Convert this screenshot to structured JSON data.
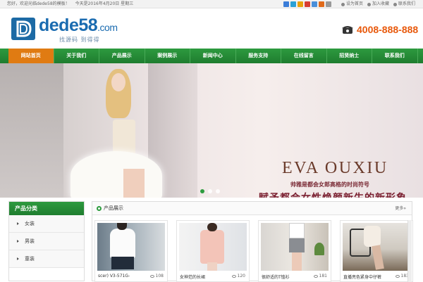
{
  "topbar": {
    "welcome": "您好，欢迎光临dede58的模板！",
    "date": "今天是2016年4月20日 星期三",
    "links": [
      "设为首页",
      "加入收藏",
      "联系我们"
    ],
    "share_icons": [
      {
        "name": "share-icon-1",
        "color": "#3b7dd8"
      },
      {
        "name": "share-icon-2",
        "color": "#2aa0d6"
      },
      {
        "name": "share-icon-3",
        "color": "#e8a10c"
      },
      {
        "name": "share-icon-4",
        "color": "#d73d32"
      },
      {
        "name": "share-icon-5",
        "color": "#4a8fd9"
      },
      {
        "name": "share-icon-6",
        "color": "#e06a1a"
      },
      {
        "name": "share-icon-7",
        "color": "#999999"
      }
    ]
  },
  "header": {
    "logo_main": "dede58",
    "logo_domain": ".com",
    "slogan": "找源码  到得得",
    "phone": "4008-888-888"
  },
  "nav": {
    "items": [
      "网站首页",
      "关于我们",
      "产品展示",
      "案例展示",
      "新闻中心",
      "服务支持",
      "在线留言",
      "招贤纳士",
      "联系我们"
    ],
    "active_index": 0
  },
  "banner": {
    "brand": "EVA OUXIU",
    "line1": "帅雅是都会女郎高格的时尚符号",
    "line2": "赋予都会女性焕颜新生的新形象",
    "slide_count": 3,
    "active_slide": 0
  },
  "sidebar": {
    "title": "产品分类",
    "items": [
      "女装",
      "男装",
      "童装"
    ]
  },
  "products": {
    "title": "产品展示",
    "more": "更多»",
    "items": [
      {
        "name": "scer) V3-571G-",
        "views": "108"
      },
      {
        "name": "女神范的长裙",
        "views": "120"
      },
      {
        "name": "很舒适的T恤衫",
        "views": "181"
      },
      {
        "name": "直播亮色紧身中仔裤",
        "views": "183"
      }
    ]
  },
  "colors": {
    "nav_green": "#2d9a3f",
    "nav_active": "#e07b12",
    "phone": "#e8590c",
    "logo_blue": "#1a6bb0"
  }
}
